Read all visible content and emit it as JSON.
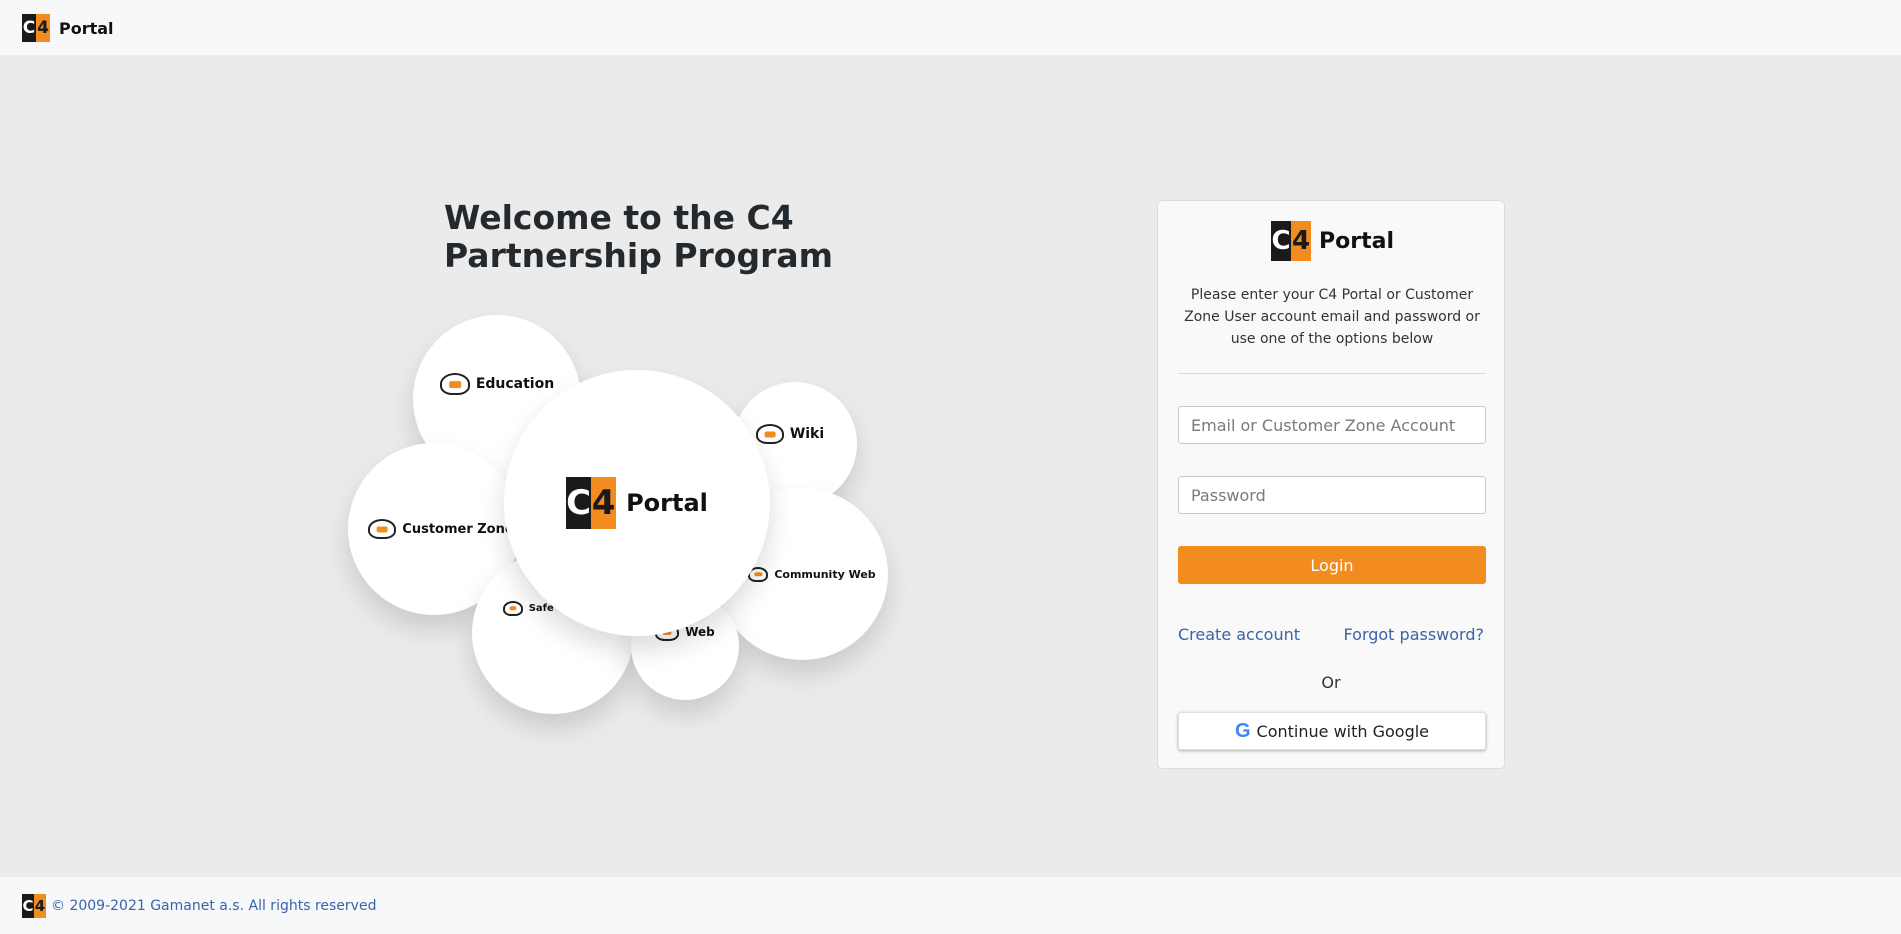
{
  "header": {
    "logo_mark": "C4",
    "brand_name": "Portal"
  },
  "welcome": {
    "title": "Welcome to the C4 Partnership Program"
  },
  "bubbles": [
    {
      "label": "Education",
      "icon": "education-cloud-icon"
    },
    {
      "label": "Portal",
      "icon": "c4-logo"
    },
    {
      "label": "Wiki",
      "icon": "wiki-cloud-icon"
    },
    {
      "label": "Customer Zone",
      "icon": "customer-zone-cloud-icon"
    },
    {
      "label": "Community Web",
      "icon": "community-web-cloud-icon"
    },
    {
      "label": "Safe Connect",
      "icon": "safe-connect-cloud-icon"
    },
    {
      "label": "Web",
      "icon": "web-cloud-icon"
    }
  ],
  "login": {
    "logo_mark": "C4",
    "brand_name": "Portal",
    "description": "Please enter your C4 Portal or Customer Zone User account email and password or use one of the options below",
    "email_placeholder": "Email or Customer Zone Account",
    "email_value": "",
    "password_placeholder": "Password",
    "password_value": "",
    "login_label": "Login",
    "create_account_label": "Create account",
    "forgot_password_label": "Forgot password?",
    "or_label": "Or",
    "google_label": "Continue with Google"
  },
  "footer": {
    "logo_mark": "C4",
    "copyright": "© 2009-2021 Gamanet a.s. All rights reserved"
  },
  "colors": {
    "accent": "#f28b20",
    "logo_dark": "#1a1a1a",
    "link": "#3a63a8",
    "page_background": "#ebebeb"
  }
}
